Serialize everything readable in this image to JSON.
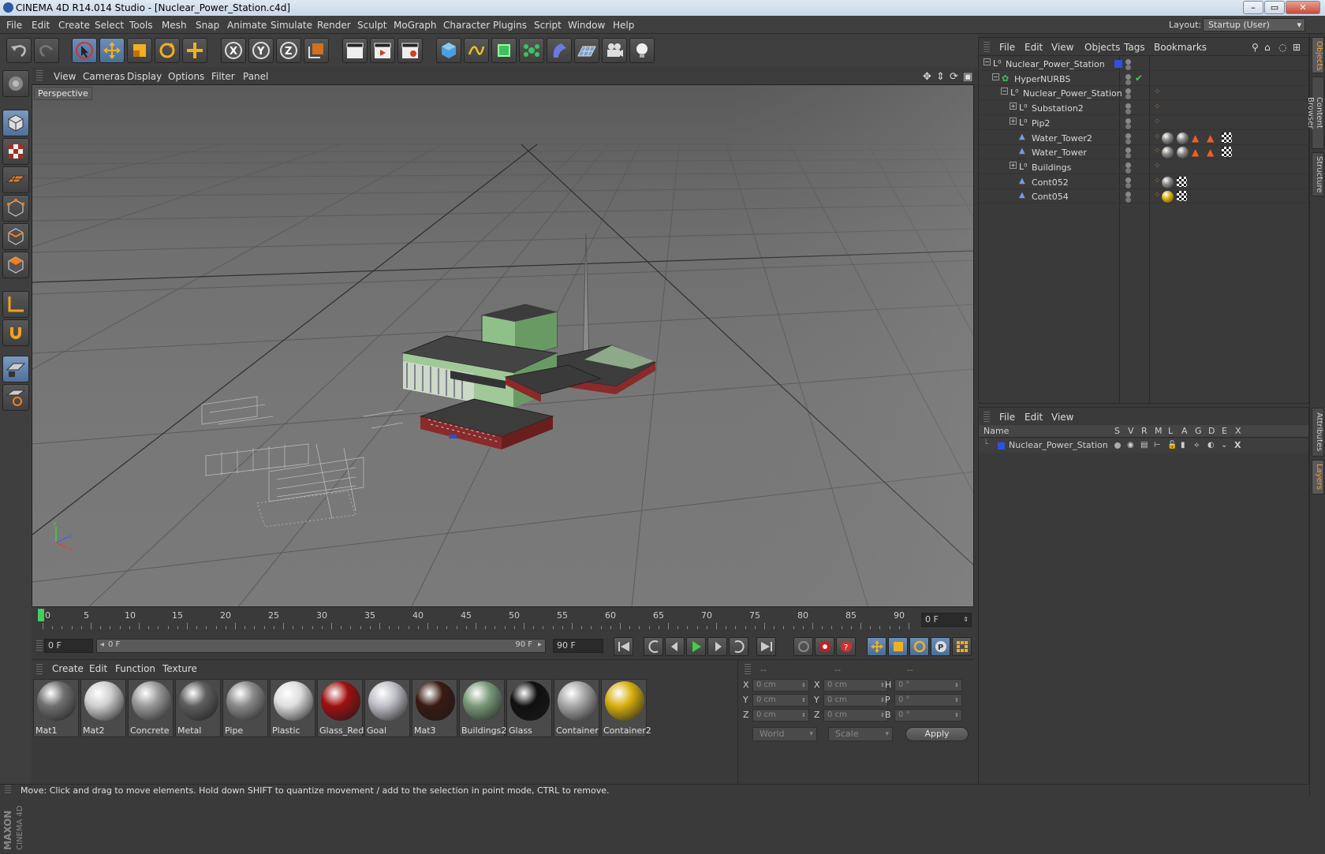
{
  "window": {
    "title": "CINEMA 4D R14.014 Studio - [Nuclear_Power_Station.c4d]"
  },
  "menubar": {
    "items": [
      "File",
      "Edit",
      "Create",
      "Select",
      "Tools",
      "Mesh",
      "Snap",
      "Animate",
      "Simulate",
      "Render",
      "Sculpt",
      "MoGraph",
      "Character",
      "Plugins",
      "Script",
      "Window",
      "Help"
    ],
    "layout_label": "Layout:",
    "layout_value": "Startup (User)"
  },
  "viewport": {
    "menu": [
      "View",
      "Cameras",
      "Display",
      "Options",
      "Filter",
      "Panel"
    ],
    "label": "Perspective"
  },
  "timeline": {
    "ticks": [
      "0",
      "5",
      "10",
      "15",
      "20",
      "25",
      "30",
      "35",
      "40",
      "45",
      "50",
      "55",
      "60",
      "65",
      "70",
      "75",
      "80",
      "85",
      "90"
    ],
    "current_frame": "0 F",
    "start_frame": "0 F",
    "range_start": "0 F",
    "range_end": "90 F",
    "end_frame": "90 F"
  },
  "materials": {
    "menu": [
      "Create",
      "Edit",
      "Function",
      "Texture"
    ],
    "items": [
      {
        "name": "Mat1",
        "color": "#707070"
      },
      {
        "name": "Mat2",
        "color": "#cfcfcf"
      },
      {
        "name": "Concrete",
        "color": "#9a9a9a"
      },
      {
        "name": "Metal",
        "color": "#5e5e5e"
      },
      {
        "name": "Pipe",
        "color": "#8a8a8a"
      },
      {
        "name": "Plastic",
        "color": "#dedede"
      },
      {
        "name": "Glass_Red",
        "color": "#a01010"
      },
      {
        "name": "Goal",
        "color": "#c0c0c8"
      },
      {
        "name": "Mat3",
        "color": "#3a1a12"
      },
      {
        "name": "Buildings2",
        "color": "#7a9a7a"
      },
      {
        "name": "Glass",
        "color": "#101010"
      },
      {
        "name": "Container",
        "color": "#a8a8a8"
      },
      {
        "name": "Container2",
        "color": "#d8b010"
      }
    ]
  },
  "coords": {
    "headers": [
      "--",
      "--",
      "--"
    ],
    "rows": [
      {
        "a": "X",
        "av": "0 cm",
        "b": "X",
        "bv": "0 cm",
        "c": "H",
        "cv": "0 °"
      },
      {
        "a": "Y",
        "av": "0 cm",
        "b": "Y",
        "bv": "0 cm",
        "c": "P",
        "cv": "0 °"
      },
      {
        "a": "Z",
        "av": "0 cm",
        "b": "Z",
        "bv": "0 cm",
        "c": "B",
        "cv": "0 °"
      }
    ],
    "space": "World",
    "mode": "Scale",
    "apply": "Apply"
  },
  "status": "Move: Click and drag to move elements. Hold down SHIFT to quantize movement / add to the selection in point mode, CTRL to remove.",
  "objects": {
    "menu": [
      "File",
      "Edit",
      "View",
      "Objects",
      "Tags",
      "Bookmarks"
    ],
    "rows": [
      {
        "name": "Nuclear_Power_Station",
        "indent": 0,
        "expander": "−",
        "icon": "null"
      },
      {
        "name": "HyperNURBS",
        "indent": 1,
        "expander": "−",
        "icon": "nurbs"
      },
      {
        "name": "Nuclear_Power_Station",
        "indent": 2,
        "expander": "−",
        "icon": "null"
      },
      {
        "name": "Substation2",
        "indent": 3,
        "expander": "+",
        "icon": "null"
      },
      {
        "name": "Pip2",
        "indent": 3,
        "expander": "+",
        "icon": "null"
      },
      {
        "name": "Water_Tower2",
        "indent": 3,
        "expander": "",
        "icon": "poly"
      },
      {
        "name": "Water_Tower",
        "indent": 3,
        "expander": "",
        "icon": "poly"
      },
      {
        "name": "Buildings",
        "indent": 3,
        "expander": "+",
        "icon": "null"
      },
      {
        "name": "Cont052",
        "indent": 3,
        "expander": "",
        "icon": "poly"
      },
      {
        "name": "Cont054",
        "indent": 3,
        "expander": "",
        "icon": "poly"
      }
    ]
  },
  "layers": {
    "menu": [
      "File",
      "Edit",
      "View"
    ],
    "columns": [
      "Name",
      "S",
      "V",
      "R",
      "M",
      "L",
      "A",
      "G",
      "D",
      "E",
      "X"
    ],
    "rows": [
      {
        "name": "Nuclear_Power_Station",
        "color": "#3050e0"
      }
    ]
  },
  "sidetabs": [
    "Objects",
    "Content Browser",
    "Structure",
    "Attributes",
    "Layers"
  ]
}
